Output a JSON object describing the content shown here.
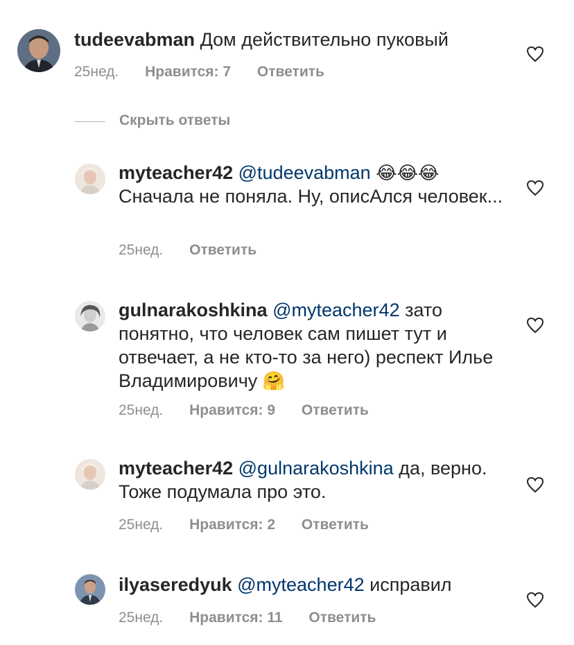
{
  "comments": [
    {
      "username": "tudeevabman",
      "mention": "",
      "text": "Дом действительно пуковый",
      "emoji": "",
      "time": "25нед.",
      "likes": "Нравится: 7",
      "reply": "Ответить"
    },
    {
      "username": "myteacher42",
      "mention": "@tudeevabman",
      "text": "Сначала не поняла. Ну, описАлся человек...",
      "emoji": "😂😂😂",
      "time": "25нед.",
      "likes": "",
      "reply": "Ответить"
    },
    {
      "username": "gulnarakoshkina",
      "mention": "@myteacher42",
      "text": "зато понятно, что человек сам пишет тут и отвечает, а не кто-то за него) респект Илье Владимировичу",
      "emoji": "🤗",
      "time": "25нед.",
      "likes": "Нравится: 9",
      "reply": "Ответить"
    },
    {
      "username": "myteacher42",
      "mention": "@gulnarakoshkina",
      "text": "да, верно. Тоже подумала про это.",
      "emoji": "",
      "time": "25нед.",
      "likes": "Нравится: 2",
      "reply": "Ответить"
    },
    {
      "username": "ilyaseredyuk",
      "mention": "@myteacher42",
      "text": "исправил",
      "emoji": "",
      "time": "25нед.",
      "likes": "Нравится: 11",
      "reply": "Ответить"
    }
  ],
  "hide_replies": "Скрыть ответы",
  "colors": {
    "text": "#262626",
    "secondary": "#8e8e8e",
    "mention": "#00376b"
  }
}
